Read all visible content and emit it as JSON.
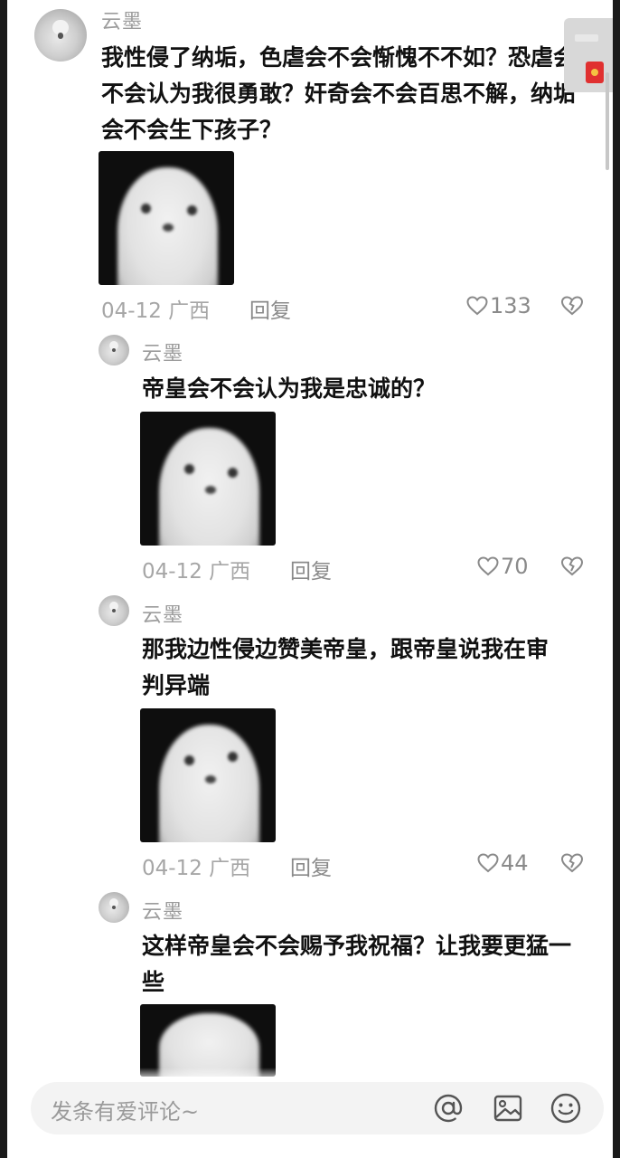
{
  "comments": [
    {
      "username": "云墨",
      "text": "我性侵了纳垢，色虐会不会惭愧不不如？恐虐会不会认为我很勇敢？奸奇会不会百思不解，纳垢会不会生下孩子？",
      "date": "04-12",
      "location": "广西",
      "reply_label": "回复",
      "likes": "133"
    },
    {
      "username": "云墨",
      "text": "帝皇会不会认为我是忠诚的？",
      "date": "04-12",
      "location": "广西",
      "reply_label": "回复",
      "likes": "70"
    },
    {
      "username": "云墨",
      "text": "那我边性侵边赞美帝皇，跟帝皇说我在审判异端",
      "date": "04-12",
      "location": "广西",
      "reply_label": "回复",
      "likes": "44"
    },
    {
      "username": "云墨",
      "text": "这样帝皇会不会赐予我祝福？让我要更猛一些"
    }
  ],
  "input": {
    "placeholder": "发条有爱评论~"
  },
  "icons": {
    "like": "heart-outline-icon",
    "dislike": "broken-heart-icon",
    "mention": "at-sign-icon",
    "image": "image-icon",
    "emoji": "emoji-smile-icon"
  }
}
